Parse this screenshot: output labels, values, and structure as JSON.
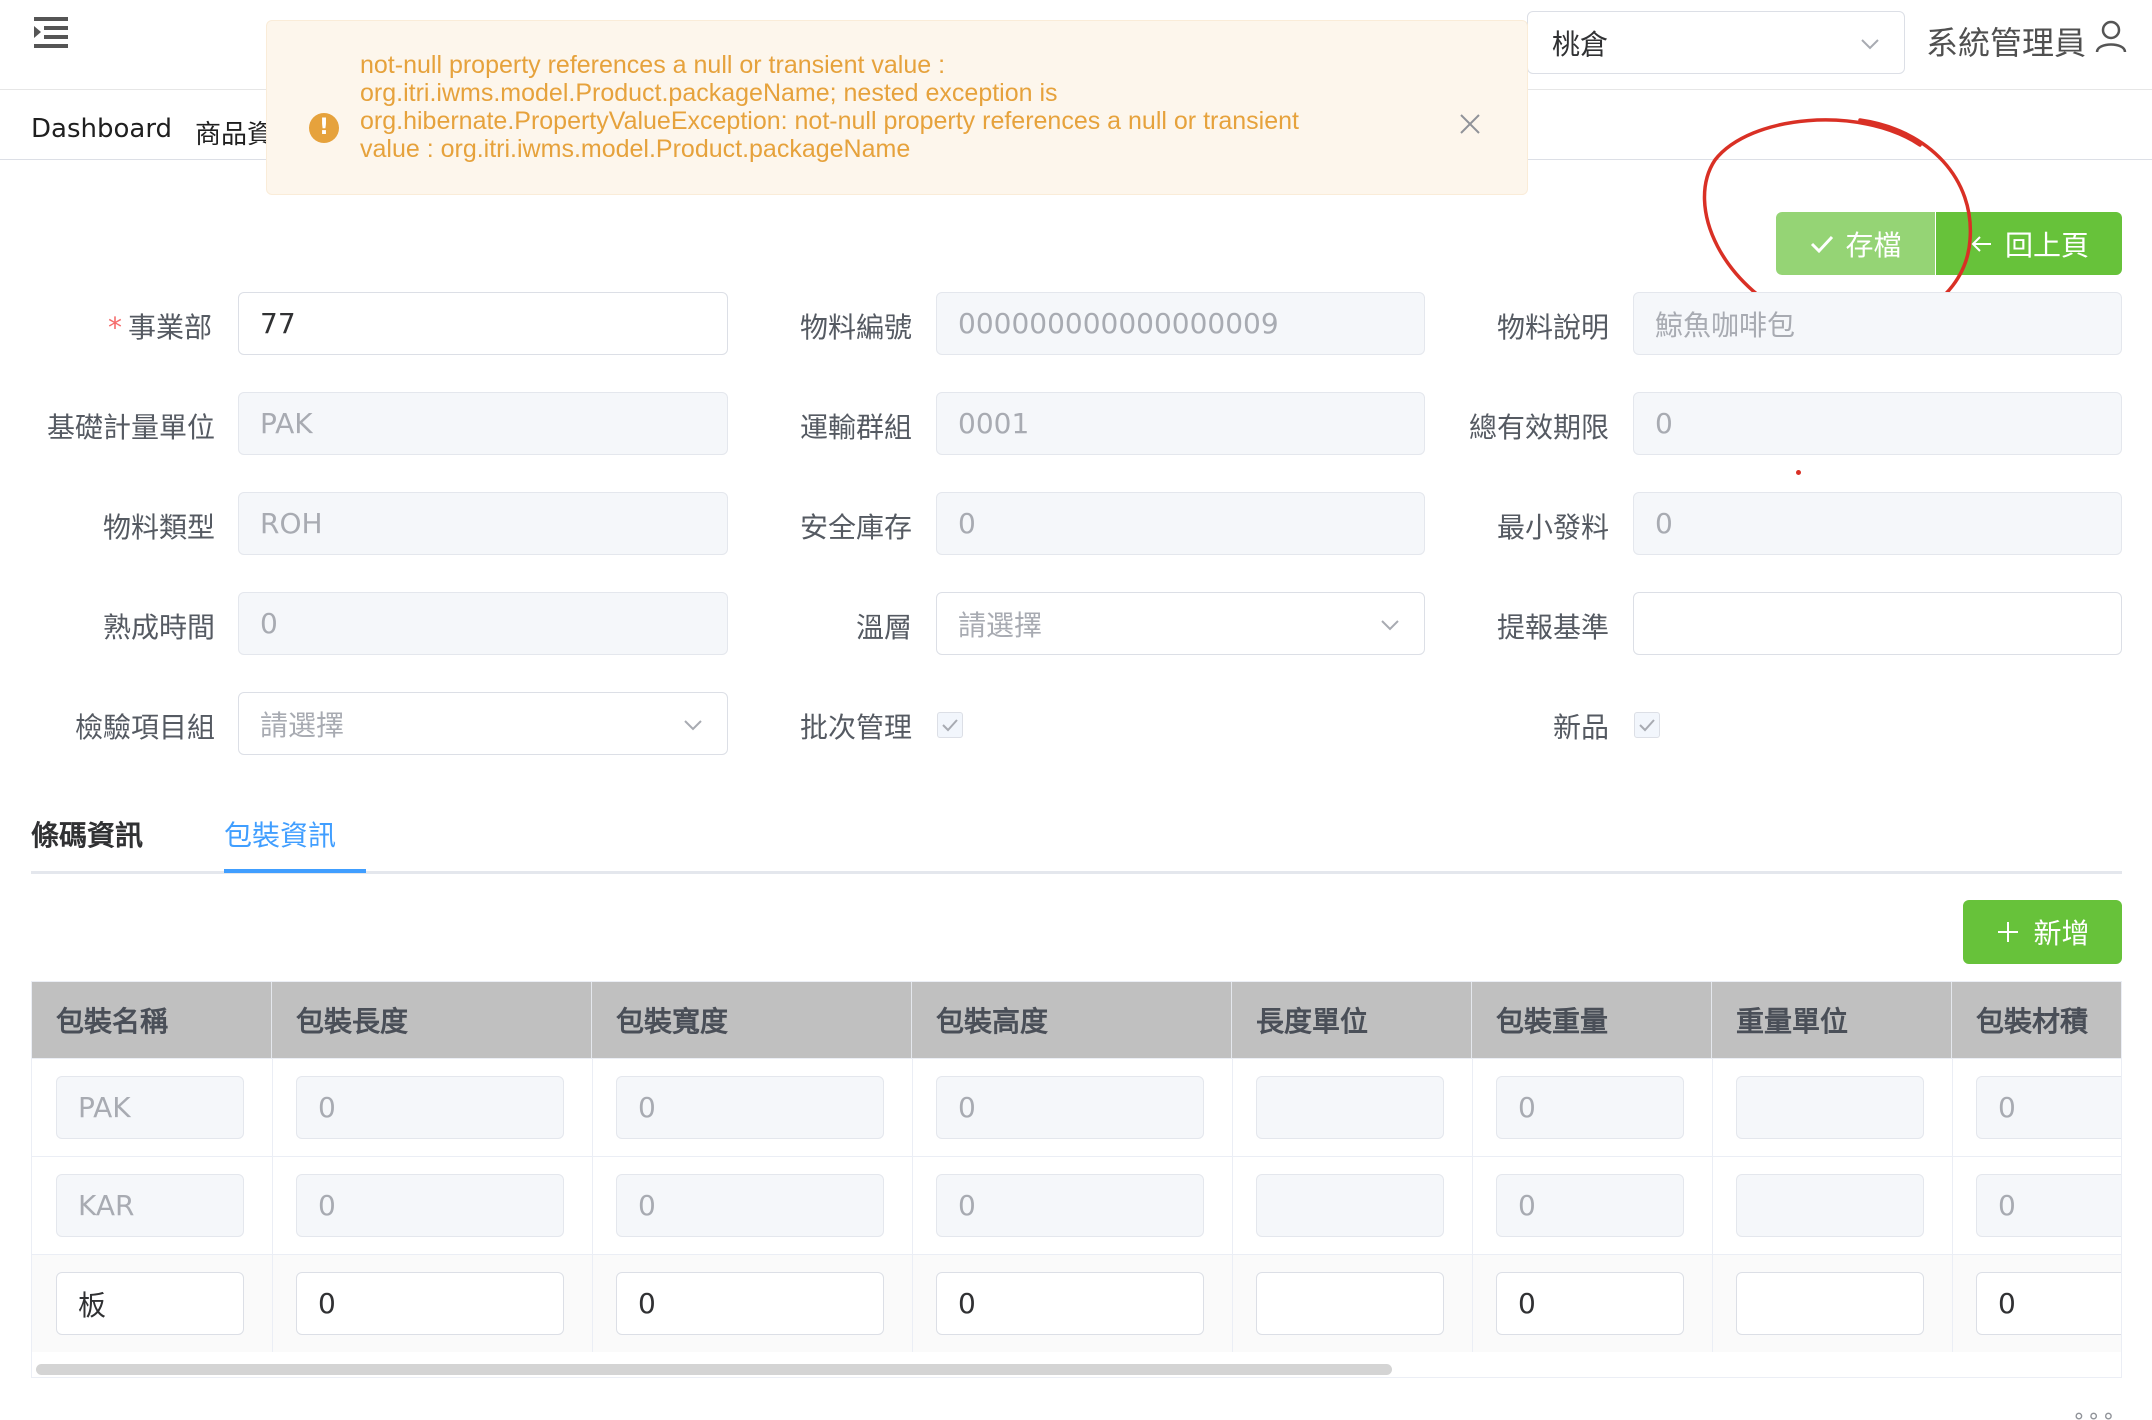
{
  "header": {
    "warehouse": "桃倉",
    "user": "系統管理員"
  },
  "tags": [
    "Dashboard",
    "商品資"
  ],
  "alert": {
    "message": "not-null property references a null or transient value : org.itri.iwms.model.Product.packageName; nested exception is org.hibernate.PropertyValueException: not-null property references a null or transient value : org.itri.iwms.model.Product.packageName"
  },
  "actions": {
    "save": "存檔",
    "back": "回上頁"
  },
  "form": {
    "business_unit": {
      "label": "事業部",
      "value": "77"
    },
    "material_no": {
      "label": "物料編號",
      "value": "000000000000000009"
    },
    "material_desc": {
      "label": "物料說明",
      "value": "鯨魚咖啡包"
    },
    "base_uom": {
      "label": "基礎計量單位",
      "value": "PAK"
    },
    "transport_group": {
      "label": "運輸群組",
      "value": "0001"
    },
    "total_shelf_life": {
      "label": "總有效期限",
      "value": "0"
    },
    "material_type": {
      "label": "物料類型",
      "value": "ROH"
    },
    "safety_stock": {
      "label": "安全庫存",
      "value": "0"
    },
    "min_issue": {
      "label": "最小發料",
      "value": "0"
    },
    "ripening_time": {
      "label": "熟成時間",
      "value": "0"
    },
    "temperature_zone": {
      "label": "溫層",
      "placeholder": "請選擇"
    },
    "report_basis": {
      "label": "提報基準",
      "value": ""
    },
    "inspection_group": {
      "label": "檢驗項目組",
      "placeholder": "請選擇"
    },
    "batch_mgmt": {
      "label": "批次管理",
      "checked": true
    },
    "new_product": {
      "label": "新品",
      "checked": true
    }
  },
  "tabs": [
    "條碼資訊",
    "包裝資訊"
  ],
  "active_tab": "包裝資訊",
  "add_button": "新增",
  "table": {
    "columns": [
      "包裝名稱",
      "包裝長度",
      "包裝寬度",
      "包裝高度",
      "長度單位",
      "包裝重量",
      "重量單位",
      "包裝材積"
    ],
    "rows": [
      {
        "name": "PAK",
        "length": "0",
        "width": "0",
        "height": "0",
        "len_unit": "",
        "weight": "0",
        "wt_unit": "",
        "volume": "0",
        "editable": false
      },
      {
        "name": "KAR",
        "length": "0",
        "width": "0",
        "height": "0",
        "len_unit": "",
        "weight": "0",
        "wt_unit": "",
        "volume": "0",
        "editable": false
      },
      {
        "name": "板",
        "length": "0",
        "width": "0",
        "height": "0",
        "len_unit": "",
        "weight": "0",
        "wt_unit": "",
        "volume": "0",
        "editable": true
      }
    ]
  },
  "colors": {
    "primary": "#409eff",
    "success": "#67c23a",
    "success_light": "#95d475",
    "warning": "#e6a23c",
    "warning_bg": "#fdf6ec",
    "annotation": "#d93025",
    "table_header": "#c0c0c0"
  }
}
